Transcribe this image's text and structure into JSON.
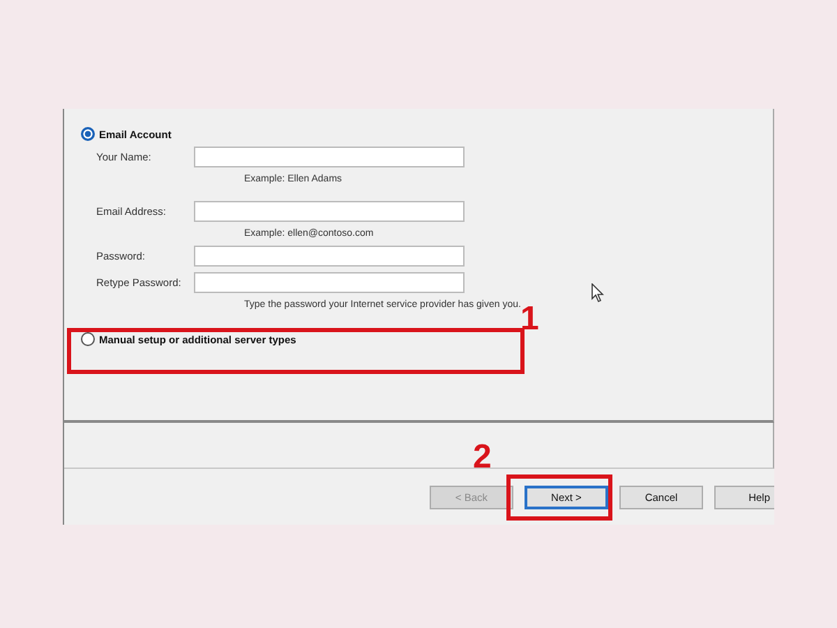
{
  "account_types": [
    {
      "label": "Email Account",
      "selected": true
    },
    {
      "label": "Manual setup or additional server types",
      "selected": false
    }
  ],
  "fields": [
    {
      "label": "Your Name:",
      "hint": "Example: Ellen Adams"
    },
    {
      "label": "Email Address:",
      "hint": "Example: ellen@contoso.com"
    },
    {
      "label": "Password:"
    },
    {
      "label": "Retype Password:",
      "hint": "Type the password your Internet service provider has given you."
    }
  ],
  "buttons": [
    {
      "label": "< Back",
      "disabled": true,
      "focused": false
    },
    {
      "label": "Next >",
      "disabled": false,
      "focused": true
    },
    {
      "label": "Cancel",
      "disabled": false,
      "focused": false
    },
    {
      "label": "Help",
      "disabled": false,
      "focused": false
    }
  ],
  "annotations": [
    {
      "number": "1"
    },
    {
      "number": "2"
    }
  ]
}
